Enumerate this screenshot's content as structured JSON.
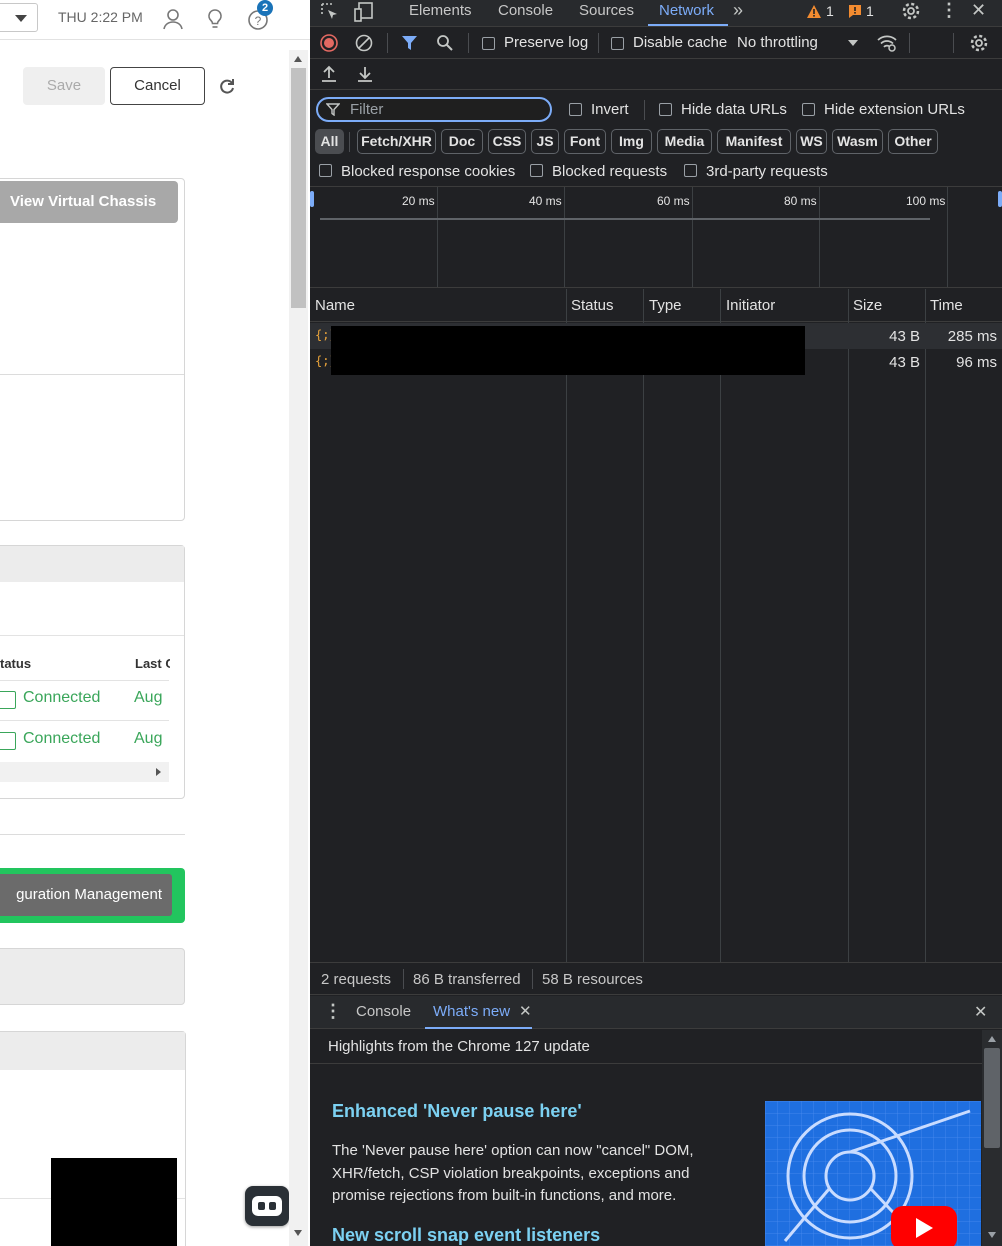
{
  "app": {
    "clock": "THU 2:22 PM",
    "notification_count": "2",
    "save_label": "Save",
    "cancel_label": "Cancel",
    "view_virtual_chassis_label": "View Virtual Chassis",
    "table": {
      "headers": [
        "tatus",
        "Last C"
      ],
      "rows": [
        {
          "status": "Connected",
          "last": "Aug"
        },
        {
          "status": "Connected",
          "last": "Aug"
        }
      ]
    },
    "config_mgmt_label": "guration Management"
  },
  "devtools": {
    "tabs": [
      "Elements",
      "Console",
      "Sources",
      "Network"
    ],
    "active_tab": "Network",
    "warning_count": "1",
    "error_count": "1",
    "toolbar": {
      "preserve_log": "Preserve log",
      "disable_cache": "Disable cache",
      "throttling": "No throttling"
    },
    "filter": {
      "placeholder": "Filter",
      "invert": "Invert",
      "hide_data_urls": "Hide data URLs",
      "hide_extension_urls": "Hide extension URLs"
    },
    "type_chips": [
      "All",
      "Fetch/XHR",
      "Doc",
      "CSS",
      "JS",
      "Font",
      "Img",
      "Media",
      "Manifest",
      "WS",
      "Wasm",
      "Other"
    ],
    "blocked": {
      "blocked_response_cookies": "Blocked response cookies",
      "blocked_requests": "Blocked requests",
      "third_party": "3rd-party requests"
    },
    "timeline_ticks": [
      "20 ms",
      "40 ms",
      "60 ms",
      "80 ms",
      "100 ms"
    ],
    "columns": [
      "Name",
      "Status",
      "Type",
      "Initiator",
      "Size",
      "Time"
    ],
    "requests": [
      {
        "icon": "{;}",
        "size": "43 B",
        "time": "285 ms"
      },
      {
        "icon": "{;}",
        "size": "43 B",
        "time": "96 ms"
      }
    ],
    "summary": {
      "requests": "2 requests",
      "transferred": "86 B transferred",
      "resources": "58 B resources"
    },
    "drawer": {
      "tabs": [
        "Console",
        "What's new"
      ],
      "active_tab": "What's new",
      "highlights": "Highlights from the Chrome 127 update",
      "items": [
        {
          "title": "Enhanced 'Never pause here'",
          "body": "The 'Never pause here' option can now \"cancel\" DOM, XHR/fetch, CSP violation breakpoints, exceptions and promise rejections from built-in functions, and more."
        },
        {
          "title": "New scroll snap event listeners",
          "body": ""
        }
      ]
    },
    "colors": {
      "accent": "#7cacf8",
      "record": "#e46962",
      "link_title": "#7cd1f2",
      "connected": "#3aa65a",
      "green_highlight": "#22c55e"
    }
  }
}
